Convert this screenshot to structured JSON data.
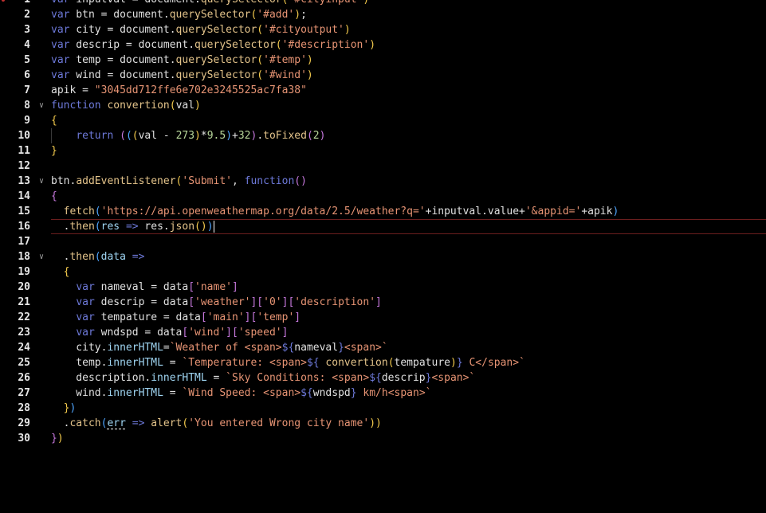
{
  "editor": {
    "language": "javascript",
    "current_line": 16,
    "lines": [
      {
        "n": "1",
        "tokens": [
          [
            "kw",
            "var"
          ],
          [
            "pl",
            " inputval = document."
          ],
          [
            "fn",
            "querySelector"
          ],
          [
            "br1",
            "("
          ],
          [
            "str",
            "'#cityinput'"
          ],
          [
            "br1",
            ")"
          ]
        ]
      },
      {
        "n": "2",
        "tokens": [
          [
            "kw",
            "var"
          ],
          [
            "pl",
            " btn = document."
          ],
          [
            "fn",
            "querySelector"
          ],
          [
            "br1",
            "("
          ],
          [
            "str",
            "'#add'"
          ],
          [
            "br1",
            ")"
          ],
          [
            "pl",
            ";"
          ]
        ]
      },
      {
        "n": "3",
        "tokens": [
          [
            "kw",
            "var"
          ],
          [
            "pl",
            " city = document."
          ],
          [
            "fn",
            "querySelector"
          ],
          [
            "br1",
            "("
          ],
          [
            "str",
            "'#cityoutput'"
          ],
          [
            "br1",
            ")"
          ]
        ]
      },
      {
        "n": "4",
        "tokens": [
          [
            "kw",
            "var"
          ],
          [
            "pl",
            " descrip = document."
          ],
          [
            "fn",
            "querySelector"
          ],
          [
            "br1",
            "("
          ],
          [
            "str",
            "'#description'"
          ],
          [
            "br1",
            ")"
          ]
        ]
      },
      {
        "n": "5",
        "tokens": [
          [
            "kw",
            "var"
          ],
          [
            "pl",
            " temp = document."
          ],
          [
            "fn",
            "querySelector"
          ],
          [
            "br1",
            "("
          ],
          [
            "str",
            "'#temp'"
          ],
          [
            "br1",
            ")"
          ]
        ]
      },
      {
        "n": "6",
        "tokens": [
          [
            "kw",
            "var"
          ],
          [
            "pl",
            " wind = document."
          ],
          [
            "fn",
            "querySelector"
          ],
          [
            "br1",
            "("
          ],
          [
            "str",
            "'#wind'"
          ],
          [
            "br1",
            ")"
          ]
        ]
      },
      {
        "n": "7",
        "tokens": [
          [
            "pl",
            "apik = "
          ],
          [
            "str",
            "\"3045dd712ffe6e702e3245525ac7fa38\""
          ]
        ]
      },
      {
        "n": "8",
        "fold": true,
        "tokens": [
          [
            "kw",
            "function"
          ],
          [
            "pl",
            " "
          ],
          [
            "fn",
            "convertion"
          ],
          [
            "br1",
            "("
          ],
          [
            "pl",
            "val"
          ],
          [
            "br1",
            ")"
          ]
        ]
      },
      {
        "n": "9",
        "tokens": [
          [
            "br1",
            "{"
          ]
        ]
      },
      {
        "n": "10",
        "guide": true,
        "tokens": [
          [
            "pl",
            "    "
          ],
          [
            "kw",
            "return"
          ],
          [
            "pl",
            " "
          ],
          [
            "br2",
            "("
          ],
          [
            "br3",
            "("
          ],
          [
            "br1",
            "("
          ],
          [
            "pl",
            "val - "
          ],
          [
            "num",
            "273"
          ],
          [
            "br1",
            ")"
          ],
          [
            "pl",
            "*"
          ],
          [
            "num",
            "9.5"
          ],
          [
            "br3",
            ")"
          ],
          [
            "pl",
            "+"
          ],
          [
            "num",
            "32"
          ],
          [
            "br2",
            ")"
          ],
          [
            "pl",
            "."
          ],
          [
            "fn",
            "toFixed"
          ],
          [
            "br2",
            "("
          ],
          [
            "num",
            "2"
          ],
          [
            "br2",
            ")"
          ]
        ]
      },
      {
        "n": "11",
        "tokens": [
          [
            "br1",
            "}"
          ]
        ]
      },
      {
        "n": "12",
        "tokens": []
      },
      {
        "n": "13",
        "fold": true,
        "tokens": [
          [
            "pl",
            "btn."
          ],
          [
            "fn",
            "addEventListener"
          ],
          [
            "br1",
            "("
          ],
          [
            "str",
            "'Submit'"
          ],
          [
            "pl",
            ", "
          ],
          [
            "kw",
            "function"
          ],
          [
            "br2",
            "()"
          ]
        ]
      },
      {
        "n": "14",
        "tokens": [
          [
            "br2",
            "{"
          ]
        ]
      },
      {
        "n": "15",
        "tokens": [
          [
            "pl",
            "  "
          ],
          [
            "fn",
            "fetch"
          ],
          [
            "br3",
            "("
          ],
          [
            "str",
            "'https://api.openweathermap.org/data/2.5/weather?q='"
          ],
          [
            "pl",
            "+inputval.value+"
          ],
          [
            "str",
            "'&appid='"
          ],
          [
            "pl",
            "+apik"
          ],
          [
            "br3",
            ")"
          ]
        ]
      },
      {
        "n": "16",
        "tokens": [
          [
            "pl",
            "  ."
          ],
          [
            "fn",
            "then"
          ],
          [
            "br3",
            "("
          ],
          [
            "prop",
            "res"
          ],
          [
            "pl",
            " "
          ],
          [
            "kw",
            "=>"
          ],
          [
            "pl",
            " res."
          ],
          [
            "fn",
            "json"
          ],
          [
            "br1",
            "()"
          ],
          [
            "br3",
            ")"
          ]
        ]
      },
      {
        "n": "17",
        "tokens": []
      },
      {
        "n": "18",
        "fold": true,
        "tokens": [
          [
            "pl",
            "  ."
          ],
          [
            "fn",
            "then"
          ],
          [
            "br3",
            "("
          ],
          [
            "prop",
            "data"
          ],
          [
            "pl",
            " "
          ],
          [
            "kw",
            "=>"
          ]
        ]
      },
      {
        "n": "19",
        "tokens": [
          [
            "pl",
            "  "
          ],
          [
            "br1",
            "{"
          ]
        ]
      },
      {
        "n": "20",
        "tokens": [
          [
            "pl",
            "    "
          ],
          [
            "kw",
            "var"
          ],
          [
            "pl",
            " nameval = data"
          ],
          [
            "br2",
            "["
          ],
          [
            "str",
            "'name'"
          ],
          [
            "br2",
            "]"
          ]
        ]
      },
      {
        "n": "21",
        "tokens": [
          [
            "pl",
            "    "
          ],
          [
            "kw",
            "var"
          ],
          [
            "pl",
            " descrip = data"
          ],
          [
            "br2",
            "["
          ],
          [
            "str",
            "'weather'"
          ],
          [
            "br2",
            "]["
          ],
          [
            "str",
            "'0'"
          ],
          [
            "br2",
            "]["
          ],
          [
            "str",
            "'description'"
          ],
          [
            "br2",
            "]"
          ]
        ]
      },
      {
        "n": "22",
        "tokens": [
          [
            "pl",
            "    "
          ],
          [
            "kw",
            "var"
          ],
          [
            "pl",
            " tempature = data"
          ],
          [
            "br2",
            "["
          ],
          [
            "str",
            "'main'"
          ],
          [
            "br2",
            "]["
          ],
          [
            "str",
            "'temp'"
          ],
          [
            "br2",
            "]"
          ]
        ]
      },
      {
        "n": "23",
        "tokens": [
          [
            "pl",
            "    "
          ],
          [
            "kw",
            "var"
          ],
          [
            "pl",
            " wndspd = data"
          ],
          [
            "br2",
            "["
          ],
          [
            "str",
            "'wind'"
          ],
          [
            "br2",
            "]["
          ],
          [
            "str",
            "'speed'"
          ],
          [
            "br2",
            "]"
          ]
        ]
      },
      {
        "n": "24",
        "tokens": [
          [
            "pl",
            "    city."
          ],
          [
            "prop",
            "innerHTML"
          ],
          [
            "pl",
            "="
          ],
          [
            "tpl",
            "`Weather of <span>"
          ],
          [
            "kw",
            "${"
          ],
          [
            "pl",
            "nameval"
          ],
          [
            "kw",
            "}"
          ],
          [
            "tpl",
            "<span>`"
          ]
        ]
      },
      {
        "n": "25",
        "tokens": [
          [
            "pl",
            "    temp."
          ],
          [
            "prop",
            "innerHTML"
          ],
          [
            "pl",
            " = "
          ],
          [
            "tpl",
            "`Temperature: <span>"
          ],
          [
            "kw",
            "${"
          ],
          [
            "pl",
            " "
          ],
          [
            "fn",
            "convertion"
          ],
          [
            "br1",
            "("
          ],
          [
            "pl",
            "tempature"
          ],
          [
            "br1",
            ")"
          ],
          [
            "kw",
            "}"
          ],
          [
            "tpl",
            " C</span>`"
          ]
        ]
      },
      {
        "n": "26",
        "tokens": [
          [
            "pl",
            "    description."
          ],
          [
            "prop",
            "innerHTML"
          ],
          [
            "pl",
            " = "
          ],
          [
            "tpl",
            "`Sky Conditions: <span>"
          ],
          [
            "kw",
            "${"
          ],
          [
            "pl",
            "descrip"
          ],
          [
            "kw",
            "}"
          ],
          [
            "tpl",
            "<span>`"
          ]
        ]
      },
      {
        "n": "27",
        "tokens": [
          [
            "pl",
            "    wind."
          ],
          [
            "prop",
            "innerHTML"
          ],
          [
            "pl",
            " = "
          ],
          [
            "tpl",
            "`Wind Speed: <span>"
          ],
          [
            "kw",
            "${"
          ],
          [
            "pl",
            "wndspd"
          ],
          [
            "kw",
            "}"
          ],
          [
            "tpl",
            " km/h<span>`"
          ]
        ]
      },
      {
        "n": "28",
        "tokens": [
          [
            "pl",
            "  "
          ],
          [
            "br1",
            "}"
          ],
          [
            "br3",
            ")"
          ]
        ]
      },
      {
        "n": "29",
        "tokens": [
          [
            "pl",
            "  ."
          ],
          [
            "fn",
            "catch"
          ],
          [
            "br3",
            "("
          ],
          [
            "prop squig",
            "err"
          ],
          [
            "pl",
            " "
          ],
          [
            "kw",
            "=>"
          ],
          [
            "pl",
            " "
          ],
          [
            "fn",
            "alert"
          ],
          [
            "br1",
            "("
          ],
          [
            "str",
            "'You entered Wrong city name'"
          ],
          [
            "br1",
            "))"
          ]
        ]
      },
      {
        "n": "30",
        "tokens": [
          [
            "br2",
            "}"
          ],
          [
            "br1",
            ")"
          ]
        ]
      }
    ]
  }
}
